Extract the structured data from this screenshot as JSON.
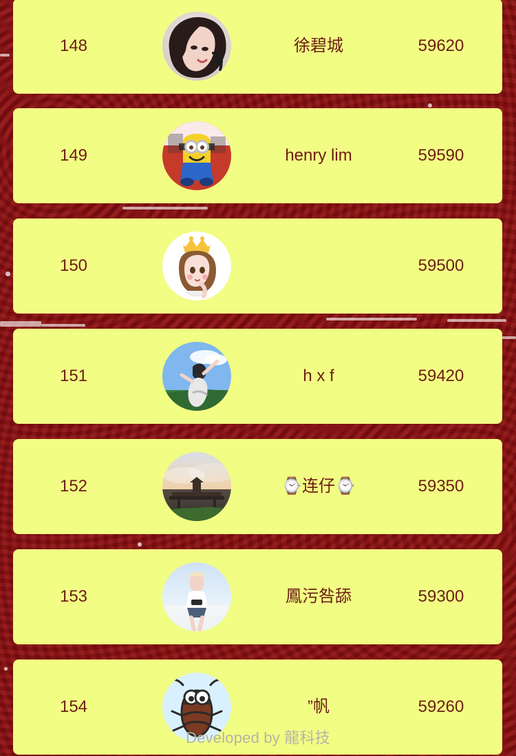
{
  "leaderboard": {
    "rows": [
      {
        "rank": "148",
        "name": "徐碧城",
        "score": "59620",
        "avatar_icon": "avatar-girl-photo-icon"
      },
      {
        "rank": "149",
        "name": "henry lim",
        "score": "59590",
        "avatar_icon": "avatar-minion-photo-icon"
      },
      {
        "rank": "150",
        "name": "",
        "score": "59500",
        "avatar_icon": "avatar-cartoon-princess-icon"
      },
      {
        "rank": "151",
        "name": "h x f",
        "score": "59420",
        "avatar_icon": "avatar-sky-person-photo-icon"
      },
      {
        "rank": "152",
        "name": "⌚连仔⌚",
        "score": "59350",
        "avatar_icon": "avatar-sunset-pier-photo-icon"
      },
      {
        "rank": "153",
        "name": "鳳污咎舔",
        "score": "59300",
        "avatar_icon": "avatar-beach-girl-photo-icon"
      },
      {
        "rank": "154",
        "name": "”帆",
        "score": "59260",
        "avatar_icon": "avatar-cartoon-bug-icon"
      }
    ]
  },
  "footer": {
    "text": "Developed by 龍科技"
  },
  "colors": {
    "background": "#8e0f10",
    "card": "#f2fd84",
    "text": "#6b1e12",
    "footer_text": "#b5b5a7"
  }
}
